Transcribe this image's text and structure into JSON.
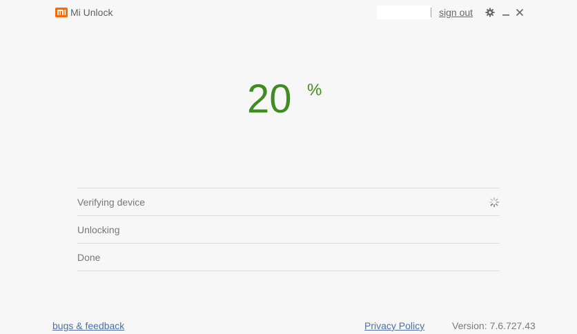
{
  "app": {
    "title": "Mi Unlock",
    "logo_text": "mi"
  },
  "titlebar": {
    "account_value": "",
    "sign_out_label": "sign out",
    "icons": [
      "gear-icon",
      "minimize-icon",
      "close-icon"
    ]
  },
  "progress": {
    "value": "20",
    "unit": "%"
  },
  "steps": [
    {
      "label": "Verifying device",
      "state": "in-progress"
    },
    {
      "label": "Unlocking",
      "state": "pending"
    },
    {
      "label": "Done",
      "state": "pending"
    }
  ],
  "footer": {
    "bugs_label": "bugs & feedback",
    "privacy_label": "Privacy Policy",
    "version_label": "Version:",
    "version_value": "7.6.727.43"
  },
  "colors": {
    "brand": "#ff6700",
    "progress": "#3f8c1f",
    "link": "#4a6fa5"
  }
}
